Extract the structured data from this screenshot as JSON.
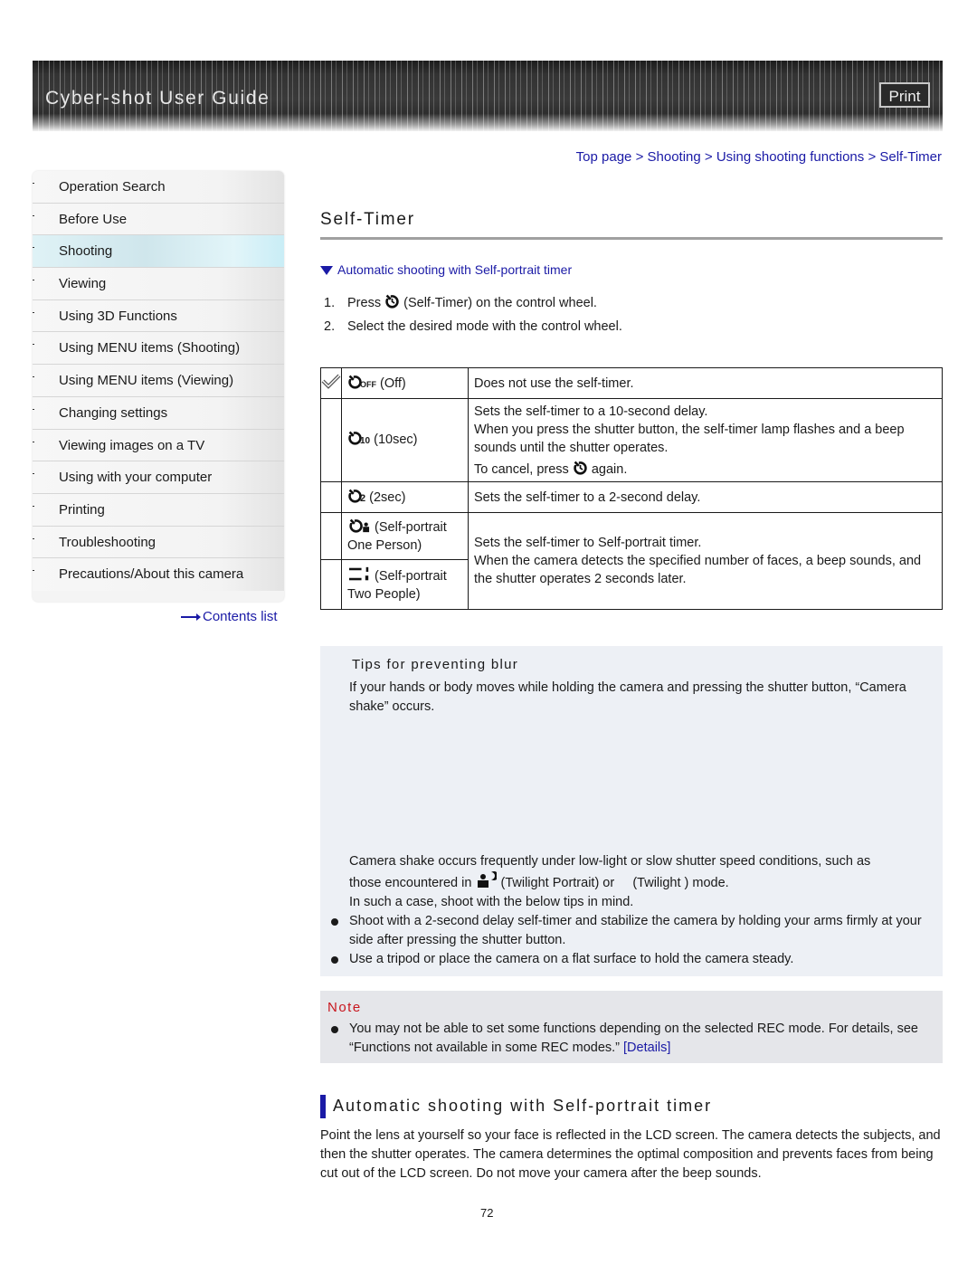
{
  "header": {
    "title": "Cyber-shot User Guide",
    "print_label": "Print"
  },
  "sidebar": {
    "items": [
      {
        "label": "Operation Search",
        "active": false
      },
      {
        "label": "Before Use",
        "active": false
      },
      {
        "label": "Shooting",
        "active": true
      },
      {
        "label": "Viewing",
        "active": false
      },
      {
        "label": "Using 3D Functions",
        "active": false
      },
      {
        "label": "Using MENU items (Shooting)",
        "active": false
      },
      {
        "label": "Using MENU items (Viewing)",
        "active": false
      },
      {
        "label": "Changing settings",
        "active": false
      },
      {
        "label": "Viewing images on a TV",
        "active": false
      },
      {
        "label": "Using with your computer",
        "active": false
      },
      {
        "label": "Printing",
        "active": false
      },
      {
        "label": "Troubleshooting",
        "active": false
      },
      {
        "label": "Precautions/About this camera",
        "active": false
      }
    ],
    "contents_link": "Contents list"
  },
  "breadcrumb": {
    "items": [
      "Top page",
      "Shooting",
      "Using shooting functions",
      "Self-Timer"
    ],
    "separator": ">"
  },
  "page": {
    "title": "Self-Timer",
    "anchor_link": "Automatic shooting with Self-portrait timer",
    "steps": [
      {
        "num": "1.",
        "before": "Press",
        "after": "(Self-Timer) on the control wheel."
      },
      {
        "num": "2.",
        "before": "Select the desired mode with the control wheel.",
        "after": ""
      }
    ]
  },
  "modes_table": {
    "rows": [
      {
        "checked": true,
        "icon": "self-timer-off-icon",
        "mode": "(Off)",
        "desc": [
          "Does not use the self-timer."
        ]
      },
      {
        "checked": false,
        "icon": "self-timer-10sec-icon",
        "mode": "(10sec)",
        "desc": [
          "Sets the self-timer to a 10-second delay.",
          "When you press the shutter button, the self-timer lamp flashes and a beep sounds until the shutter operates."
        ],
        "cancel_before": "To cancel, press",
        "cancel_after": "again."
      },
      {
        "checked": false,
        "icon": "self-timer-2sec-icon",
        "mode": "(2sec)",
        "desc": [
          "Sets the self-timer to a 2-second delay."
        ]
      },
      {
        "checked": false,
        "icon": "self-portrait-one-icon",
        "mode": "(Self-portrait One Person)",
        "desc": [
          "Sets the self-timer to Self-portrait timer.",
          "When the camera detects the specified number of faces, a beep sounds, and the shutter operates 2 seconds later."
        ]
      },
      {
        "checked": false,
        "icon": "self-portrait-two-icon",
        "mode": "(Self-portrait Two People)"
      }
    ]
  },
  "tips": {
    "title": "Tips for preventing blur",
    "intro": "If your hands or body moves while holding the camera and pressing the shutter button, “Camera shake” occurs.",
    "body_line1": "Camera shake occurs frequently under low-light or slow shutter speed conditions, such as",
    "body_line2_before": "those encountered in",
    "body_line2_after": "(Twilight Portrait) or     (Twilight ) mode.",
    "body_line3": "In such a case, shoot with the below tips in mind.",
    "bullets": [
      "Shoot with a 2-second delay self-timer and stabilize the camera by holding your arms firmly at your side after pressing the shutter button.",
      "Use a tripod or place the camera on a flat surface to hold the camera steady."
    ]
  },
  "note": {
    "title": "Note",
    "text": "You may not be able to set some functions depending on the selected REC mode. For details, see “Functions not available in some REC modes.”",
    "details_link": "[Details]"
  },
  "section": {
    "heading": "Automatic shooting with Self-portrait timer",
    "paragraph": "Point the lens at yourself so your face is reflected in the LCD screen. The camera detects the subjects, and then the shutter operates. The camera determines the optimal composition and prevents faces from being cut out of the LCD screen. Do not move your camera after the beep sounds."
  },
  "footer": {
    "page_number": "72"
  },
  "colors": {
    "link": "#1a1aa6",
    "note_title": "#c8161e",
    "tips_bg": "#edf0f5",
    "note_bg": "#e5e6ea",
    "active_nav": "#cfe6ec"
  }
}
